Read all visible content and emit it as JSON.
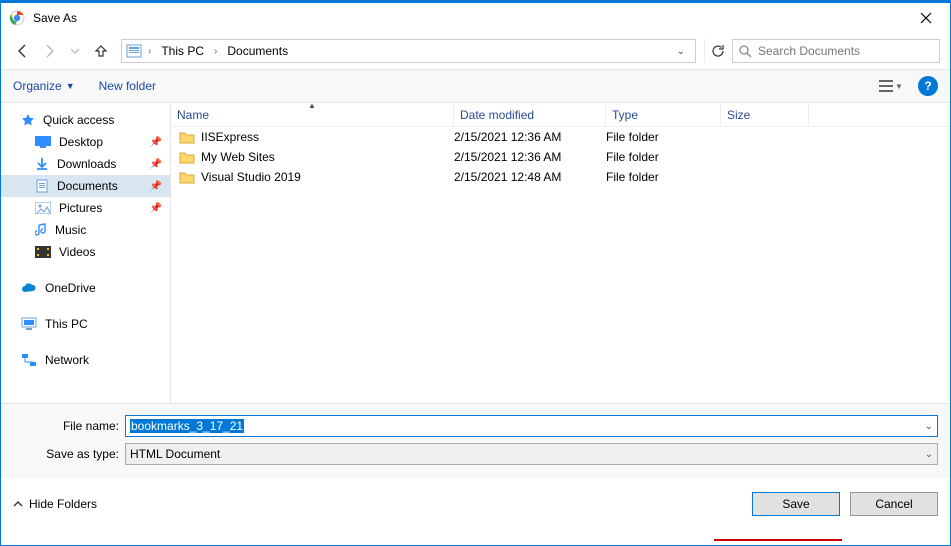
{
  "window": {
    "title": "Save As"
  },
  "breadcrumb": {
    "root_label": "This PC",
    "current": "Documents"
  },
  "search": {
    "placeholder": "Search Documents"
  },
  "toolbar": {
    "organize": "Organize",
    "new_folder": "New folder",
    "help": "?"
  },
  "sidebar": {
    "quick_access": "Quick access",
    "items": [
      {
        "label": "Desktop",
        "pinned": true
      },
      {
        "label": "Downloads",
        "pinned": true
      },
      {
        "label": "Documents",
        "pinned": true
      },
      {
        "label": "Pictures",
        "pinned": true
      },
      {
        "label": "Music",
        "pinned": false
      },
      {
        "label": "Videos",
        "pinned": false
      }
    ],
    "onedrive": "OneDrive",
    "thispc": "This PC",
    "network": "Network"
  },
  "columns": {
    "name": "Name",
    "date": "Date modified",
    "type": "Type",
    "size": "Size"
  },
  "files": [
    {
      "name": "IISExpress",
      "date": "2/15/2021 12:36 AM",
      "type": "File folder"
    },
    {
      "name": "My Web Sites",
      "date": "2/15/2021 12:36 AM",
      "type": "File folder"
    },
    {
      "name": "Visual Studio 2019",
      "date": "2/15/2021 12:48 AM",
      "type": "File folder"
    }
  ],
  "fields": {
    "filename_label": "File name:",
    "filename_value": "bookmarks_3_17_21",
    "saveastype_label": "Save as type:",
    "saveastype_value": "HTML Document"
  },
  "footer": {
    "hide_folders": "Hide Folders",
    "save": "Save",
    "cancel": "Cancel"
  }
}
